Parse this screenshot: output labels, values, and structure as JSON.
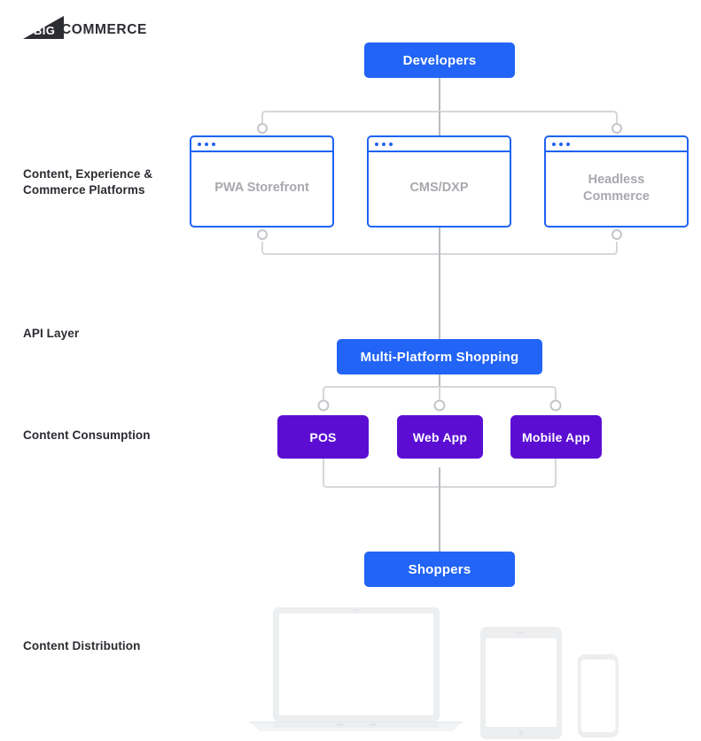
{
  "brand": {
    "logo_mark_text": "BIG",
    "logo_word": "COMMERCE",
    "accent_blue": "#2264f5",
    "card_border_blue": "#1f63f2",
    "purple": "#5b0ed2",
    "connector_gray": "#d5d7da",
    "label_dark": "#2b2b31",
    "card_label_gray": "#a9a9ae",
    "device_gray": "#eceef0"
  },
  "row_labels": [
    {
      "key": "platforms",
      "text": "Content, Experience &\nCommerce Platforms"
    },
    {
      "key": "api",
      "text": "API Layer"
    },
    {
      "key": "consumption",
      "text": "Content Consumption"
    },
    {
      "key": "distribution",
      "text": "Content Distribution"
    }
  ],
  "nodes": {
    "developers": "Developers",
    "multi_platform_shopping": "Multi-Platform Shopping",
    "shoppers": "Shoppers"
  },
  "platform_cards": [
    {
      "key": "pwa",
      "label": "PWA Storefront"
    },
    {
      "key": "cms",
      "label": "CMS/DXP"
    },
    {
      "key": "headless",
      "label": "Headless\nCommerce"
    }
  ],
  "consumption_boxes": [
    {
      "key": "pos",
      "label": "POS"
    },
    {
      "key": "web",
      "label": "Web App"
    },
    {
      "key": "mobile",
      "label": "Mobile App"
    }
  ],
  "devices": [
    {
      "key": "laptop",
      "name": "laptop-device"
    },
    {
      "key": "tablet",
      "name": "tablet-device"
    },
    {
      "key": "phone",
      "name": "phone-device"
    }
  ]
}
